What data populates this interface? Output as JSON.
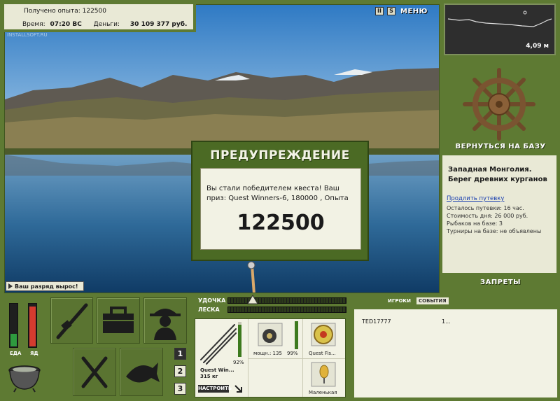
{
  "hud": {
    "experience_label": "Получено опыта:",
    "experience_value": "122500",
    "time_label": "Время:",
    "time_value": "07:20 ВС",
    "money_label": "Деньги:",
    "money_value": "30 109 377 руб.",
    "watermark": "INSTALLSOFT.RU"
  },
  "top_buttons": {
    "pause_label": "II",
    "sound_label": "S",
    "menu_label": "МЕНЮ"
  },
  "rank_message": "Ваш разряд вырос!",
  "warning": {
    "title": "ПРЕДУПРЕЖДЕНИЕ",
    "text": "Вы стали победителем квеста! Ваш приз: Quest Winners-6, 180000 , Опыта",
    "value": "122500"
  },
  "depth": {
    "value": "4,09 м"
  },
  "right_panel": {
    "return_label": "ВЕРНУТЬСЯ НА БАЗУ",
    "location_line1": "Западная Монголия.",
    "location_line2": "Берег древних курганов",
    "extend_link": "Продлить путевку",
    "trip_left": "Осталось путевки: 16 час.",
    "day_cost": "Стоимость дня: 26 000 руб.",
    "anglers": "Рыбаков на базе: 3",
    "tournaments": "Турниры на базе: не объявлены",
    "bans_label": "ЗАПРЕТЫ"
  },
  "gauges": {
    "food_label": "ЕДА",
    "rd_label": "ЯД",
    "food_level": 0.3,
    "rd_level": 0.95
  },
  "numbers": [
    "1",
    "2",
    "3"
  ],
  "bars": {
    "rod_label": "УДОЧКА",
    "line_label": "ЛЕСКА"
  },
  "tackle": {
    "rod_name": "Quest Win...",
    "rod_weight": "315 кг",
    "rod_durability": "92%",
    "reel_power": "мощн.: 135",
    "reel_durability": "99%",
    "line_name": "Quest Fis...",
    "lure_name": "Маленькая",
    "tune_button": "НАСТРОИТЬ"
  },
  "players": {
    "tab_players": "ИГРОКИ",
    "tab_events": "СОБЫТИЯ",
    "list": [
      {
        "name": "TED17777",
        "value": "1..."
      }
    ]
  }
}
